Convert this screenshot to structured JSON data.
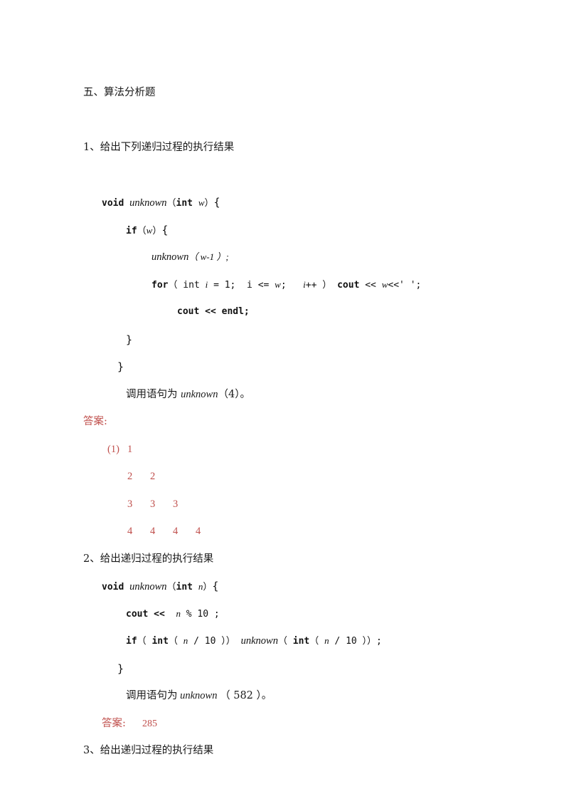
{
  "document": {
    "section_heading": "五、算法分析题",
    "colors": {
      "text": "#1a1a1a",
      "answer_red": "#c0504d",
      "page_background": "#ffffff"
    }
  },
  "questions": [
    {
      "number_label": "1、给出下列递归过程的执行结果",
      "code": {
        "line1_kw": "void",
        "line1_name": "unknown",
        "line1_open_paren": "（",
        "line1_type": "int",
        "line1_param": "w",
        "line1_close_paren": "）",
        "line1_brace": "{",
        "line2_kw": "if",
        "line2_open": "（",
        "line2_cond": "w",
        "line2_close": "）",
        "line2_brace": "{",
        "line3_call": "unknown",
        "line3_args": "（ w-1 ）;",
        "line4_kw": "for",
        "line4_rest1": "（ int ",
        "line4_i1": "i",
        "line4_rest2": " = 1;  i <= ",
        "line4_w": "w",
        "line4_rest3": ";   ",
        "line4_i2": "i",
        "line4_rest4": "++ ） ",
        "line4_cout": "cout",
        "line4_rest5": " << ",
        "line4_w2": "w",
        "line4_rest6": "<<' ';",
        "line5_cout": "cout",
        "line5_rest": " << endl;",
        "line6_brace": "}",
        "line7_brace": "}"
      },
      "call_statement": {
        "prefix": "调用语句为 ",
        "name": "unknown",
        "suffix": "（4）。"
      },
      "answer_label": "答案:",
      "answer_grid": {
        "item_label": "(1)",
        "rows": [
          [
            "1"
          ],
          [
            "2",
            "2"
          ],
          [
            "3",
            "3",
            "3"
          ],
          [
            "4",
            "4",
            "4",
            "4"
          ]
        ]
      }
    },
    {
      "number_label": "2、给出递归过程的执行结果",
      "code": {
        "line1_kw": "void",
        "line1_name": "unknown",
        "line1_open_paren": "（",
        "line1_type": "int",
        "line1_param": "n",
        "line1_close_paren": "）",
        "line1_brace": "{",
        "line2_cout": "cout",
        "line2_rest1": " <<  ",
        "line2_n": "n",
        "line2_rest2": " % 10 ;",
        "line3_kw": "if",
        "line3_rest1": "（ ",
        "line3_int1": "int",
        "line3_rest2": "（ ",
        "line3_n1": "n",
        "line3_rest3": " / 10 ）） ",
        "line3_call": "unknown",
        "line3_rest4": "（ ",
        "line3_int2": "int",
        "line3_rest5": "（ ",
        "line3_n2": "n",
        "line3_rest6": " / 10 ））;",
        "line4_brace": "}"
      },
      "call_statement": {
        "prefix": "调用语句为",
        "name": " unknown ",
        "suffix": "（ 582 ）。"
      },
      "answer_label": "答案:",
      "answer_value": "285"
    },
    {
      "number_label": "3、给出递归过程的执行结果"
    }
  ]
}
